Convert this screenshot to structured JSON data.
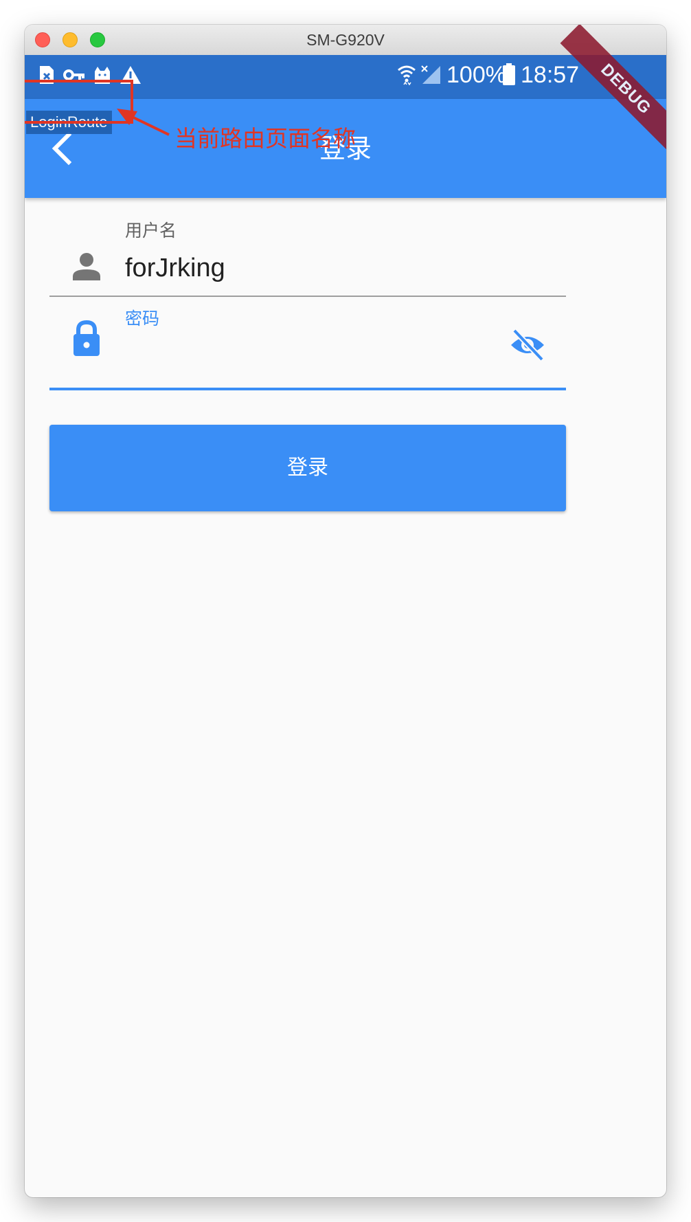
{
  "window": {
    "title": "SM-G920V"
  },
  "status_bar": {
    "left_icons": [
      "sim-error-icon",
      "vpn-key-icon",
      "cat-app-icon",
      "warning-icon"
    ],
    "right_icons": [
      "wifi-icon",
      "cellular-no-signal-icon",
      "battery-icon"
    ],
    "battery_text": "100%",
    "time": "18:57"
  },
  "app_bar": {
    "title": "登录",
    "back_icon": "chevron-left-icon",
    "color": "#3a8ef6"
  },
  "route_label": "LoginRoute",
  "annotation": {
    "text": "当前路由页面名称",
    "color": "#e03524"
  },
  "debug_banner": "DEBUG",
  "form": {
    "username": {
      "label": "用户名",
      "value": "forJrking",
      "icon": "person-icon"
    },
    "password": {
      "label": "密码",
      "value": "",
      "icon": "lock-icon",
      "toggle_icon": "visibility-off-icon"
    },
    "submit_label": "登录"
  },
  "colors": {
    "primary": "#3a8ef6",
    "status_bar": "#2a6fc9",
    "annotation": "#e03524"
  }
}
